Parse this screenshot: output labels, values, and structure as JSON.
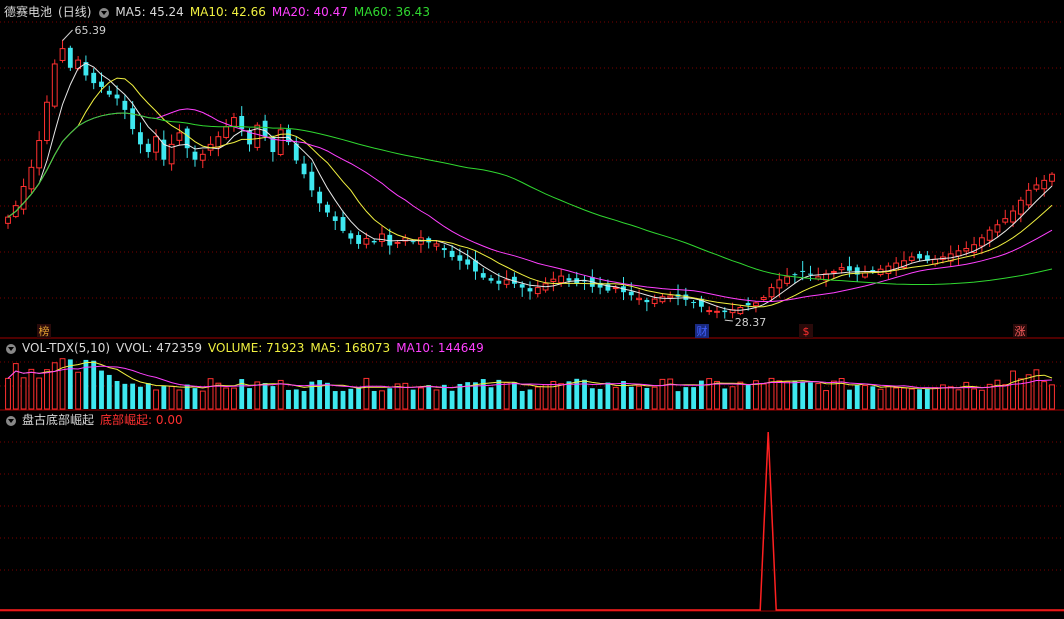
{
  "colors": {
    "up": "#ff3030",
    "down": "#3ee8f0",
    "ma5": "#e8e8e8",
    "ma10": "#f0f040",
    "ma20": "#ff40ff",
    "ma60": "#30d830",
    "grid": "#7a0000",
    "signal": "#ff2020"
  },
  "main_panel": {
    "stock_name": "德赛电池",
    "period": "(日线)",
    "ma5_label": "MA5: 45.24",
    "ma10_label": "MA10: 42.66",
    "ma20_label": "MA20: 40.47",
    "ma60_label": "MA60: 36.43",
    "high_marker": "65.39",
    "low_marker": "28.37",
    "event_badges": [
      "榜",
      "财",
      "$",
      "涨"
    ]
  },
  "volume_panel": {
    "indicator": "VOL-TDX(5,10)",
    "vvol_label": "VVOL: 472359",
    "volume_label": "VOLUME: 71923",
    "ma5_label": "MA5: 168073",
    "ma10_label": "MA10: 144649"
  },
  "indicator_panel": {
    "name": "盘古底部崛起",
    "series_label": "底部崛起: 0.00"
  },
  "chart_data": [
    {
      "type": "candlestick",
      "title": "德赛电池 (日线)",
      "ylim": [
        26,
        67
      ],
      "series": [
        {
          "name": "MA5",
          "value": 45.24
        },
        {
          "name": "MA10",
          "value": 42.66
        },
        {
          "name": "MA20",
          "value": 40.47
        },
        {
          "name": "MA60",
          "value": 36.43
        }
      ],
      "annotations": [
        {
          "label": "65.39",
          "kind": "period-high"
        },
        {
          "label": "28.37",
          "kind": "period-low"
        }
      ],
      "closes": [
        41,
        42.5,
        45,
        47.5,
        51,
        56,
        61,
        63,
        60.5,
        61.5,
        59.5,
        58.5,
        58,
        57,
        56.5,
        55,
        52.5,
        50.5,
        49.5,
        51.5,
        48.5,
        50.5,
        52,
        50,
        48.5,
        49.2,
        50.5,
        51.5,
        52.8,
        54,
        52.5,
        50.5,
        53,
        51.5,
        49.5,
        52.4,
        50.8,
        48.4,
        46.6,
        44.5,
        42.8,
        41.6,
        40.5,
        39.2,
        38.2,
        37.5,
        38.2,
        37.7,
        38.8,
        37.3,
        37.7,
        38.3,
        37.8,
        38.3,
        37.7,
        37.5,
        36.7,
        35.8,
        35.3,
        34.8,
        33.9,
        33.1,
        32.7,
        32.3,
        32.8,
        32.3,
        31.8,
        31.3,
        31.8,
        32.3,
        32.9,
        33.3,
        32.7,
        32.3,
        32.6,
        31.9,
        31.8,
        31.4,
        31.8,
        31.2,
        30.8,
        30.4,
        29.9,
        30.3,
        30.6,
        30.7,
        30.6,
        30.2,
        29.8,
        29.3,
        28.8,
        28.7,
        28.6,
        28.9,
        29.2,
        29.5,
        29.8,
        30.5,
        31.8,
        32.8,
        33.2,
        33.5,
        33.9,
        33.5,
        33.2,
        33.6,
        33.9,
        34.4,
        34.0,
        33.5,
        33.7,
        33.9,
        34.2,
        34.6,
        35.0,
        35.3,
        35.8,
        35.6,
        35.3,
        35.5,
        35.8,
        36.2,
        36.6,
        36.9,
        37.4,
        38.3,
        39.3,
        40.0,
        40.8,
        41.8,
        43.2,
        44.5,
        45.2,
        45.8,
        46.6
      ]
    },
    {
      "type": "bar",
      "title": "VOL-TDX(5,10)",
      "series": [
        {
          "name": "VVOL",
          "value": 472359
        },
        {
          "name": "VOLUME",
          "value": 71923
        },
        {
          "name": "MA5",
          "value": 168073
        },
        {
          "name": "MA10",
          "value": 144649
        }
      ]
    },
    {
      "type": "line",
      "title": "盘古底部崛起",
      "series": [
        {
          "name": "底部崛起",
          "value": 0.0,
          "peak_fraction_of_width": 0.722
        }
      ]
    }
  ]
}
